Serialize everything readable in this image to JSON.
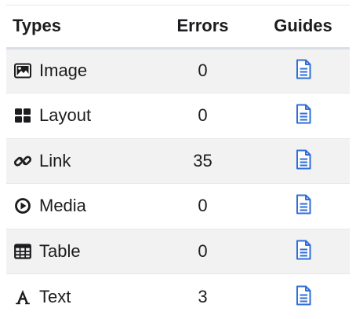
{
  "header": {
    "types": "Types",
    "errors": "Errors",
    "guides": "Guides"
  },
  "rows": [
    {
      "label": "Image",
      "errors": "0",
      "icon": "image-icon"
    },
    {
      "label": "Layout",
      "errors": "0",
      "icon": "layout-grid-icon"
    },
    {
      "label": "Link",
      "errors": "35",
      "icon": "link-icon"
    },
    {
      "label": "Media",
      "errors": "0",
      "icon": "play-circle-icon"
    },
    {
      "label": "Table",
      "errors": "0",
      "icon": "table-icon"
    },
    {
      "label": "Text",
      "errors": "3",
      "icon": "text-icon"
    }
  ],
  "guide_icon": "document-icon",
  "colors": {
    "guide_icon": "#2f6fd6",
    "row_stripe": "#f2f2f2",
    "text": "#1c1c1e"
  }
}
